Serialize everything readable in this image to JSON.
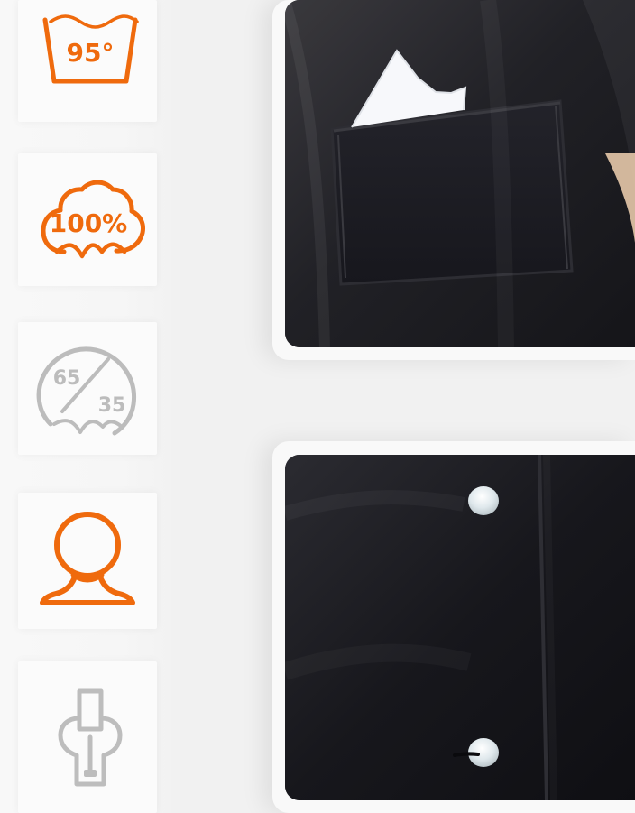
{
  "care_icons": {
    "wash": {
      "label": "95°",
      "color": "#ef6a0d"
    },
    "cotton": {
      "label": "100%",
      "color": "#ef6a0d"
    },
    "blend": {
      "top": "65",
      "bottom": "35",
      "color": "#b8b8b8"
    },
    "person": {
      "color": "#ef6a0d"
    },
    "zipper": {
      "color": "#b8b8b8"
    }
  },
  "photos": {
    "top": "pocket-detail",
    "bottom": "button-placket-detail"
  }
}
